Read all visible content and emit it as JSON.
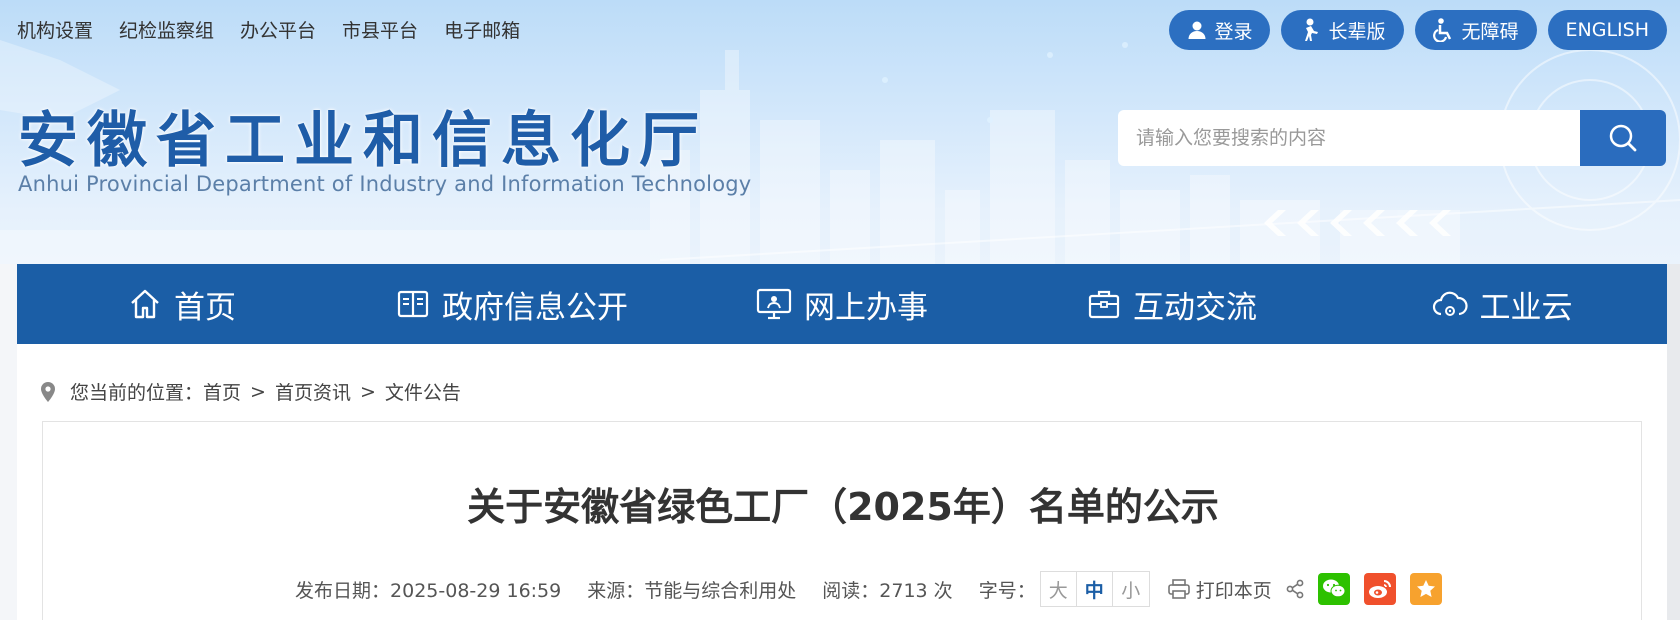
{
  "top_links": [
    "机构设置",
    "纪检监察组",
    "办公平台",
    "市县平台",
    "电子邮箱"
  ],
  "top_buttons": {
    "login": "登录",
    "elder": "长辈版",
    "accessible": "无障碍",
    "english": "ENGLISH"
  },
  "site": {
    "name_cn": "安徽省工业和信息化厅",
    "name_en": "Anhui Provincial Department of Industry and Information Technology"
  },
  "search": {
    "placeholder": "请输入您要搜索的内容"
  },
  "nav": [
    {
      "label": "首页",
      "icon": "home-icon"
    },
    {
      "label": "政府信息公开",
      "icon": "book-icon"
    },
    {
      "label": "网上办事",
      "icon": "monitor-person-icon"
    },
    {
      "label": "互动交流",
      "icon": "briefcase-icon"
    },
    {
      "label": "工业云",
      "icon": "cloud-gear-icon"
    }
  ],
  "breadcrumb": {
    "prefix": "您当前的位置：",
    "items": [
      "首页",
      "首页资讯",
      "文件公告"
    ],
    "separator": ">"
  },
  "article": {
    "title": "关于安徽省绿色工厂（2025年）名单的公示",
    "date_label": "发布日期：",
    "date": "2025-08-29 16:59",
    "source_label": "来源：",
    "source": "节能与综合利用处",
    "reads_label": "阅读：",
    "reads": "2713 次",
    "font_label": "字号：",
    "font_sizes": [
      "大",
      "中",
      "小"
    ],
    "print_label": "打印本页"
  },
  "colors": {
    "primary_blue": "#1b5ea6",
    "pill_blue": "#2c6fc1",
    "wechat_green": "#2dc100",
    "weibo_orange": "#f0502c",
    "favorite_orange": "#f7a22e"
  }
}
